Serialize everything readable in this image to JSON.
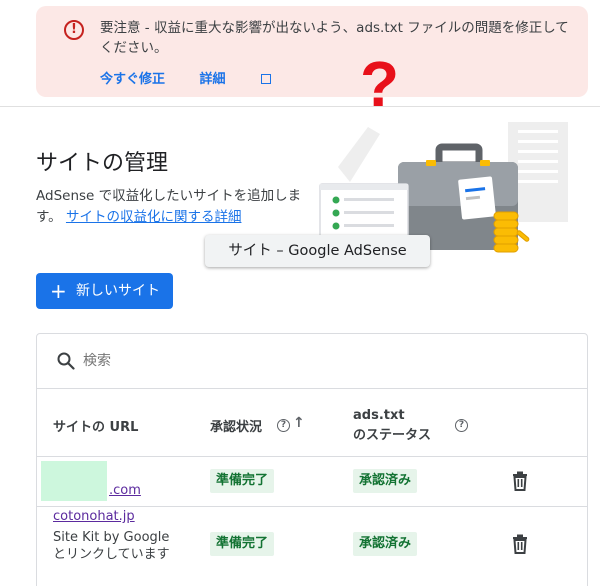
{
  "alert": {
    "message": "要注意 - 収益に重大な影響が出ないよう、ads.txt ファイルの問題を修正してください。",
    "fix_label": "今すぐ修正",
    "details_label": "詳細"
  },
  "overlay": {
    "question_mark": "?"
  },
  "page": {
    "title": "サイトの管理",
    "description": "AdSense で収益化したいサイトを追加します。",
    "description_link": "サイトの収益化に関する詳細"
  },
  "tooltip": {
    "text": "サイト – Google AdSense"
  },
  "new_site_button": {
    "plus": "+",
    "label": "新しいサイト"
  },
  "search": {
    "placeholder": "検索"
  },
  "table": {
    "headers": {
      "url": "サイトの URL",
      "status": "承認状況",
      "sort_arrow": "↑",
      "ads_line1": "ads.txt",
      "ads_line2": "のステータス"
    },
    "rows": [
      {
        "url": ".com",
        "status": "準備完了",
        "ads_status": "承認済み"
      },
      {
        "url": "cotonohat.jp",
        "note": "Site Kit by Google とリンクしています",
        "status": "準備完了",
        "ads_status": "承認済み"
      }
    ]
  },
  "colors": {
    "accent": "#1a73e8",
    "alert_bg": "#fce8e6",
    "error": "#c5221f",
    "success_bg": "#e6f4ea",
    "success_text": "#137333",
    "overlay_mark": "#e8101a"
  }
}
